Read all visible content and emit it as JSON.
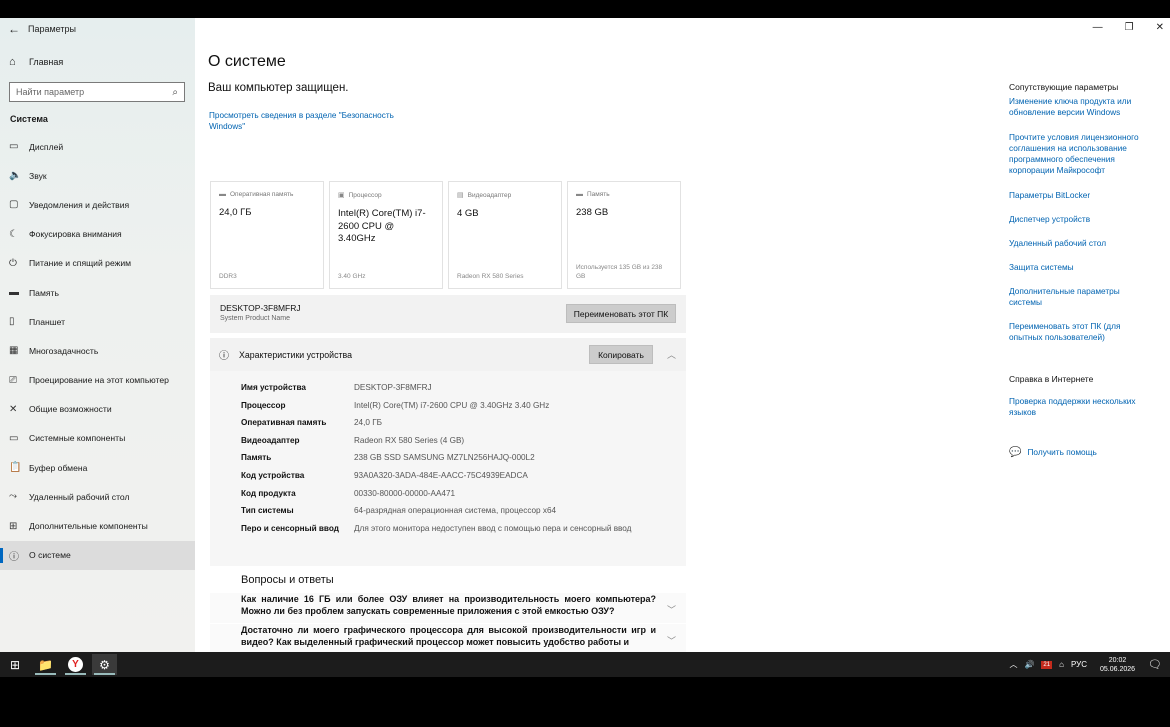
{
  "window": {
    "title": "Параметры",
    "controls": {
      "minimize": "—",
      "restore": "❐",
      "close": "✕"
    }
  },
  "sidebar": {
    "home_label": "Главная",
    "search_placeholder": "Найти параметр",
    "section_title": "Система",
    "items": [
      {
        "label": "Дисплей",
        "icon": "display-icon",
        "glyph": "▭"
      },
      {
        "label": "Звук",
        "icon": "sound-icon",
        "glyph": "🔈"
      },
      {
        "label": "Уведомления и действия",
        "icon": "notifications-icon",
        "glyph": "▢"
      },
      {
        "label": "Фокусировка внимания",
        "icon": "focus-assist-icon",
        "glyph": "☾"
      },
      {
        "label": "Питание и спящий режим",
        "icon": "power-icon",
        "glyph": "⏻"
      },
      {
        "label": "Память",
        "icon": "storage-icon",
        "glyph": "▬"
      },
      {
        "label": "Планшет",
        "icon": "tablet-icon",
        "glyph": "▯"
      },
      {
        "label": "Многозадачность",
        "icon": "multitasking-icon",
        "glyph": "▦"
      },
      {
        "label": "Проецирование на этот компьютер",
        "icon": "projecting-icon",
        "glyph": "⎚"
      },
      {
        "label": "Общие возможности",
        "icon": "shared-experiences-icon",
        "glyph": "✕"
      },
      {
        "label": "Системные компоненты",
        "icon": "system-components-icon",
        "glyph": "▭"
      },
      {
        "label": "Буфер обмена",
        "icon": "clipboard-icon",
        "glyph": "📋"
      },
      {
        "label": "Удаленный рабочий стол",
        "icon": "remote-desktop-icon",
        "glyph": "⤳"
      },
      {
        "label": "Дополнительные компоненты",
        "icon": "optional-features-icon",
        "glyph": "⊞"
      },
      {
        "label": "О системе",
        "icon": "info-icon",
        "glyph": "ⓘ",
        "active": true
      }
    ]
  },
  "main": {
    "title": "О системе",
    "protected_text": "Ваш компьютер защищен.",
    "security_link": "Просмотреть сведения в разделе \"Безопасность Windows\"",
    "cards": [
      {
        "label": "Оперативная память",
        "value": "24,0 ГБ",
        "sub": "DDR3",
        "icon": "ram-icon",
        "glyph": "▬"
      },
      {
        "label": "Процессор",
        "value": "Intel(R) Core(TM) i7-2600 CPU @ 3.40GHz",
        "sub": "3.40 GHz",
        "icon": "cpu-icon",
        "glyph": "▣"
      },
      {
        "label": "Видеоадаптер",
        "value": "4 GB",
        "sub": "Radeon RX 580 Series",
        "icon": "gpu-icon",
        "glyph": "▤"
      },
      {
        "label": "Память",
        "value": "238 GB",
        "sub": "Используется 135 GB из 238 GB",
        "icon": "storage-icon",
        "glyph": "▬"
      }
    ],
    "device": {
      "name": "DESKTOP-3F8MFRJ",
      "model": "System Product Name",
      "rename_button": "Переименовать этот ПК"
    },
    "specs": {
      "header": "Характеристики устройства",
      "copy_button": "Копировать",
      "rows": [
        {
          "key": "Имя устройства",
          "value": "DESKTOP-3F8MFRJ"
        },
        {
          "key": "Процессор",
          "value": "Intel(R) Core(TM) i7-2600 CPU @ 3.40GHz   3.40 GHz"
        },
        {
          "key": "Оперативная память",
          "value": "24,0 ГБ"
        },
        {
          "key": "Видеоадаптер",
          "value": "Radeon RX 580 Series (4 GB)"
        },
        {
          "key": "Память",
          "value": "238 GB SSD SAMSUNG MZ7LN256HAJQ-000L2"
        },
        {
          "key": "Код устройства",
          "value": "93A0A320-3ADA-484E-AACC-75C4939EADCA"
        },
        {
          "key": "Код продукта",
          "value": "00330-80000-00000-AA471"
        },
        {
          "key": "Тип системы",
          "value": "64-разрядная операционная система, процессор x64"
        },
        {
          "key": "Перо и сенсорный ввод",
          "value": "Для этого монитора недоступен ввод с помощью пера и сенсорный ввод"
        }
      ]
    },
    "faq": {
      "title": "Вопросы и ответы",
      "items": [
        "Как наличие 16 ГБ или более ОЗУ влияет на производительность моего компьютера? Можно ли без проблем запускать современные приложения с этой емкостью ОЗУ?",
        "Достаточно ли моего графического процессора для высокой производительности игр и видео? Как выделенный графический процессор может повысить удобство работы и"
      ]
    }
  },
  "right": {
    "related_title": "Сопутствующие параметры",
    "related_links": [
      "Изменение ключа продукта или обновление версии Windows",
      "Прочтите условия лицензионного соглашения на использование программного обеспечения корпорации Майкрософт",
      "Параметры BitLocker",
      "Диспетчер устройств",
      "Удаленный рабочий стол",
      "Защита системы",
      "Дополнительные параметры системы",
      "Переименовать этот ПК (для опытных пользователей)"
    ],
    "web_title": "Справка в Интернете",
    "web_links": [
      "Проверка поддержки нескольких языков"
    ],
    "get_help": "Получить помощь"
  },
  "taskbar": {
    "apps": [
      {
        "name": "file-explorer-icon",
        "glyph": "📁",
        "active": false
      },
      {
        "name": "yandex-browser-icon",
        "glyph": "Y",
        "active": false
      },
      {
        "name": "settings-icon",
        "glyph": "⚙",
        "active": true
      }
    ],
    "language": "РУС",
    "notification_count": "21",
    "time": "20:02",
    "date": "05.06.2026"
  }
}
